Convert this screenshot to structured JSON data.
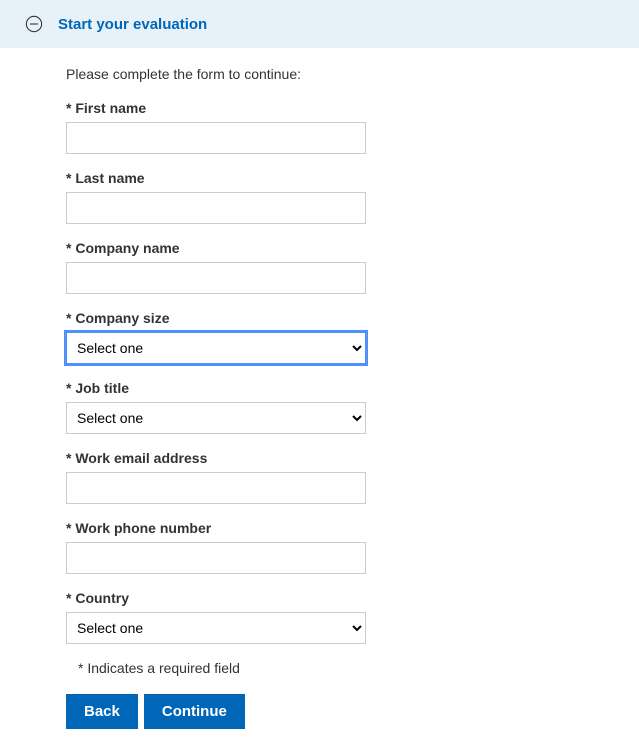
{
  "header": {
    "title": "Start your evaluation"
  },
  "form": {
    "instruction": "Please complete the form to continue:",
    "fields": {
      "first_name": {
        "label": "* First name",
        "value": ""
      },
      "last_name": {
        "label": "* Last name",
        "value": ""
      },
      "company_name": {
        "label": "* Company name",
        "value": ""
      },
      "company_size": {
        "label": "* Company size",
        "selected": "Select one"
      },
      "job_title": {
        "label": "* Job title",
        "selected": "Select one"
      },
      "work_email": {
        "label": "* Work email address",
        "value": ""
      },
      "work_phone": {
        "label": "* Work phone number",
        "value": ""
      },
      "country": {
        "label": "* Country",
        "selected": "Select one"
      }
    },
    "required_note": "* Indicates a required field",
    "buttons": {
      "back": "Back",
      "continue": "Continue"
    }
  }
}
